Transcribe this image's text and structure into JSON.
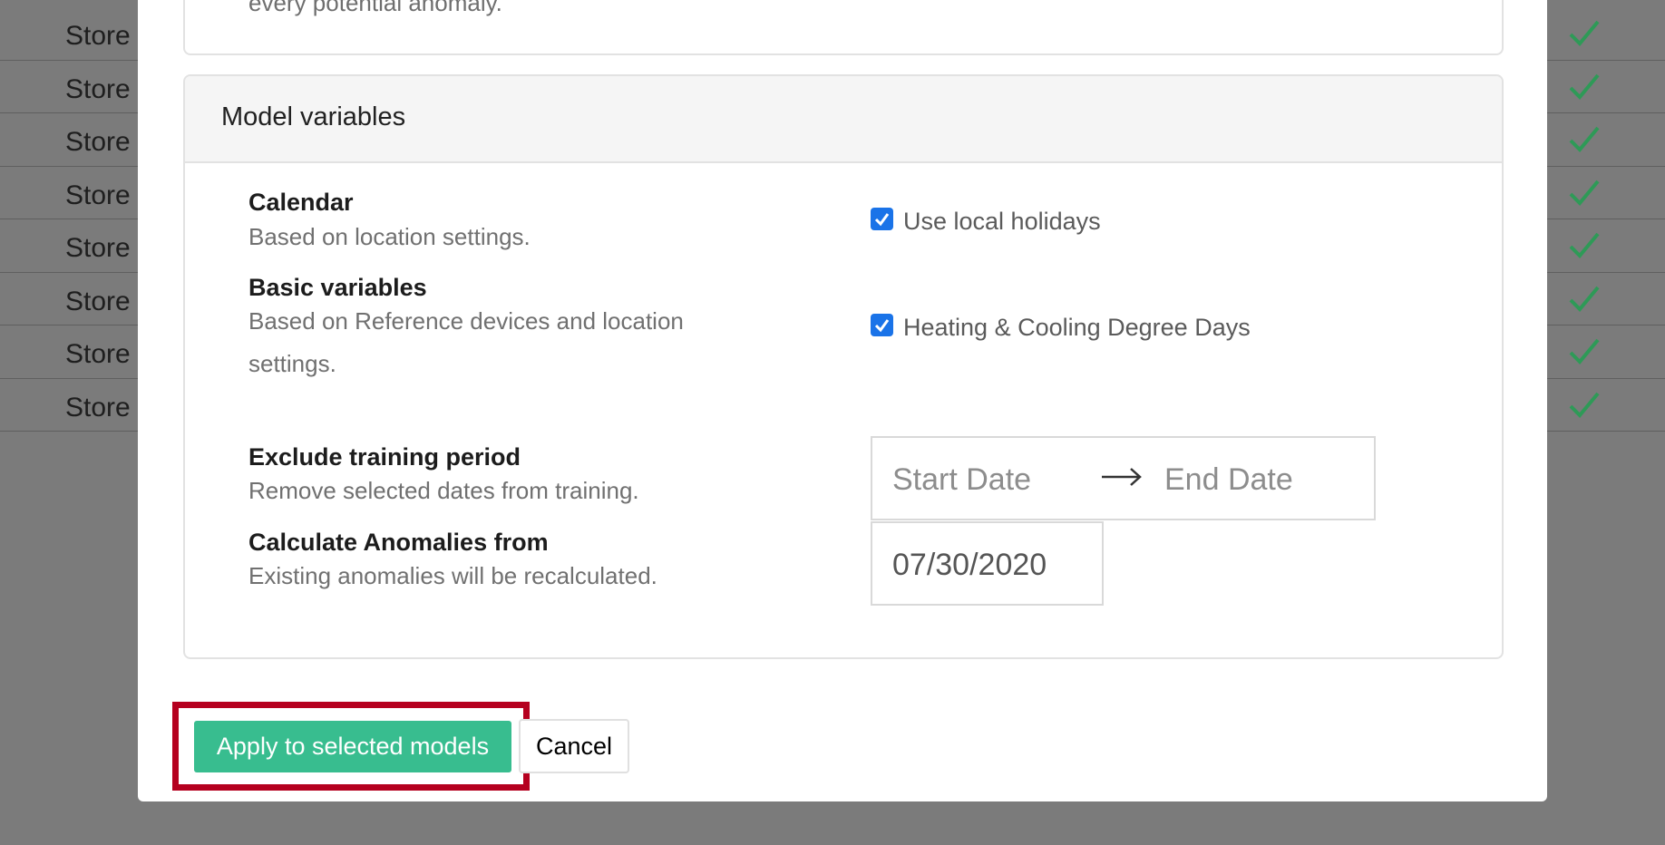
{
  "background_table": {
    "rows": [
      {
        "label": "Store"
      },
      {
        "label": "Store"
      },
      {
        "label": "Store"
      },
      {
        "label": "Store"
      },
      {
        "label": "Store"
      },
      {
        "label": "Store"
      },
      {
        "label": "Store"
      },
      {
        "label": "Store"
      }
    ],
    "status_icon": "checkmark-icon",
    "status_color": "#2e9a57"
  },
  "modal": {
    "previous_card_text": "every potential anomaly.",
    "model_variables": {
      "title": "Model variables",
      "calendar": {
        "title": "Calendar",
        "description": "Based on location settings.",
        "option_label": "Use local holidays",
        "checked": true
      },
      "basic_variables": {
        "title": "Basic variables",
        "description": "Based on Reference devices and location settings.",
        "option_label": "Heating & Cooling Degree Days",
        "checked": true
      },
      "exclude_training": {
        "title": "Exclude training period",
        "description": "Remove selected dates from training.",
        "start_placeholder": "Start Date",
        "end_placeholder": "End Date",
        "arrow_icon": "arrow-right-icon"
      },
      "calculate_from": {
        "title": "Calculate Anomalies from",
        "description": "Existing anomalies will be recalculated.",
        "date_value": "07/30/2020"
      }
    },
    "footer": {
      "apply_label": "Apply to selected models",
      "cancel_label": "Cancel"
    }
  },
  "colors": {
    "overlay": "#7b7b7b",
    "checkbox": "#1a73e8",
    "apply_button": "#38bd8f",
    "highlight": "#b5001f"
  }
}
